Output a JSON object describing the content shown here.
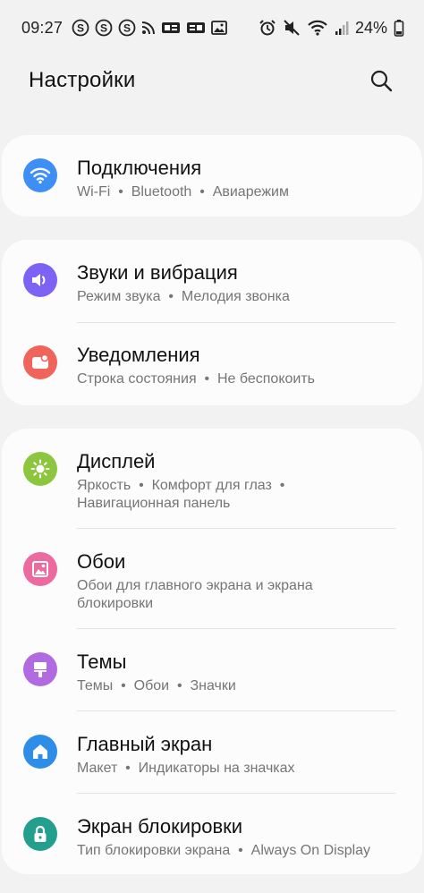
{
  "status_bar": {
    "time": "09:27",
    "battery": "24%"
  },
  "header": {
    "title": "Настройки"
  },
  "colors": {
    "connections": "#3d8ef5",
    "sounds": "#7d63f3",
    "notifications": "#f0655b",
    "display": "#8cc63f",
    "wallpaper": "#ec6a9e",
    "themes": "#b26ae0",
    "home_screen": "#2e8de6",
    "lock_screen": "#22a08d"
  },
  "groups": [
    {
      "items": [
        {
          "title": "Подключения",
          "subtitle": "Wi-Fi  •  Bluetooth  •  Авиарежим",
          "icon": "wifi-icon"
        }
      ]
    },
    {
      "items": [
        {
          "title": "Звуки и вибрация",
          "subtitle": "Режим звука  •  Мелодия звонка",
          "icon": "speaker-icon"
        },
        {
          "title": "Уведомления",
          "subtitle": "Строка состояния  •  Не беспокоить",
          "icon": "notification-icon"
        }
      ]
    },
    {
      "items": [
        {
          "title": "Дисплей",
          "subtitle_line1": "Яркость  •  Комфорт для глаз  •",
          "subtitle_line2": "Навигационная панель",
          "icon": "brightness-icon"
        },
        {
          "title": "Обои",
          "subtitle_line1": "Обои для главного экрана и экрана",
          "subtitle_line2": "блокировки",
          "icon": "wallpaper-icon"
        },
        {
          "title": "Темы",
          "subtitle": "Темы  •  Обои  •  Значки",
          "icon": "themes-icon"
        },
        {
          "title": "Главный экран",
          "subtitle": "Макет  •  Индикаторы на значках",
          "icon": "home-icon"
        },
        {
          "title": "Экран блокировки",
          "subtitle": "Тип блокировки экрана  •  Always On Display",
          "icon": "lock-icon"
        }
      ]
    }
  ]
}
